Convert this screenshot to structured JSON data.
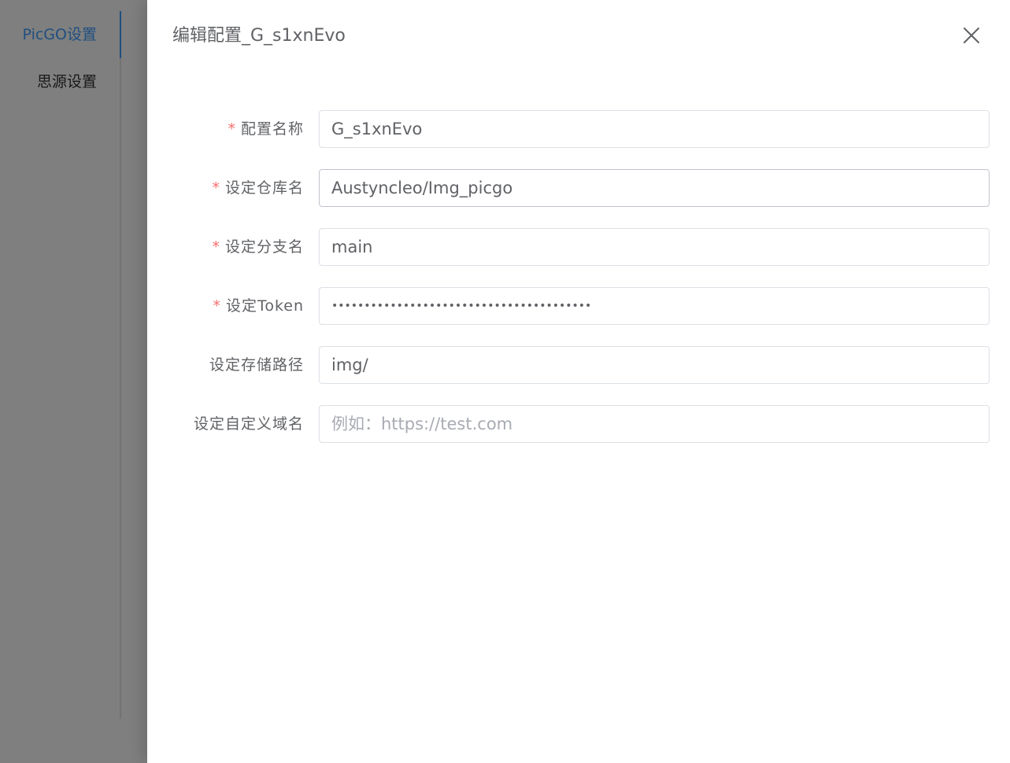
{
  "sidebar": {
    "items": [
      {
        "label": "PicGO设置",
        "active": true
      },
      {
        "label": "思源设置",
        "active": false
      }
    ]
  },
  "drawer": {
    "title": "编辑配置_G_s1xnEvo",
    "close_icon": "close-icon"
  },
  "form": {
    "fields": [
      {
        "label": "配置名称",
        "required": true,
        "value": "G_s1xnEvo",
        "placeholder": "",
        "type": "text"
      },
      {
        "label": "设定仓库名",
        "required": true,
        "value": "Austyncleo/Img_picgo",
        "placeholder": "",
        "type": "text"
      },
      {
        "label": "设定分支名",
        "required": true,
        "value": "main",
        "placeholder": "",
        "type": "text"
      },
      {
        "label": "设定Token",
        "required": true,
        "value": "••••••••••••••••••••••••••••••••••••••••",
        "placeholder": "",
        "type": "text"
      },
      {
        "label": "设定存储路径",
        "required": false,
        "value": "img/",
        "placeholder": "",
        "type": "text"
      },
      {
        "label": "设定自定义域名",
        "required": false,
        "value": "",
        "placeholder": "例如：https://test.com",
        "type": "text"
      }
    ]
  },
  "colors": {
    "accent": "#409eff",
    "required": "#f56c6c",
    "text": "#606266",
    "overlay": "rgba(0,0,0,0.5)"
  }
}
